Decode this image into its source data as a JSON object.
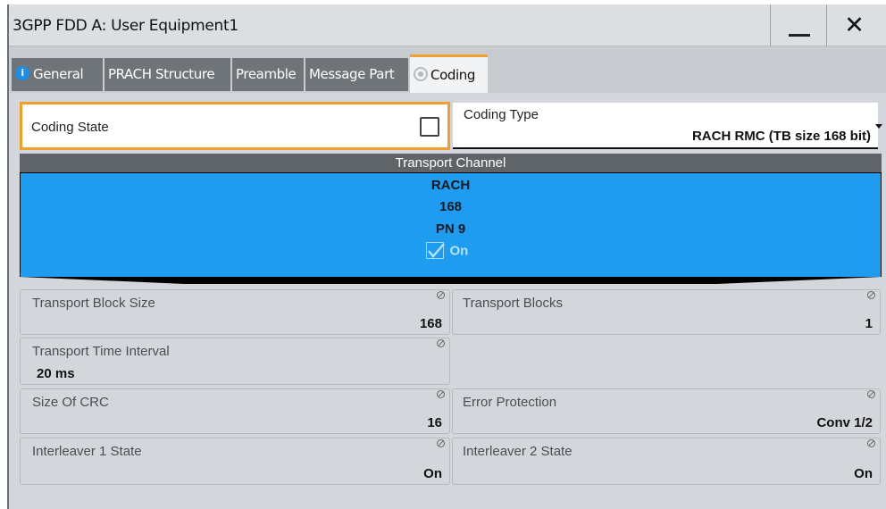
{
  "window": {
    "title": "3GPP FDD A: User Equipment1",
    "minimize_icon": "minimize-icon",
    "close_label": "✕"
  },
  "tabs": [
    {
      "label": "General",
      "icon": "info-icon"
    },
    {
      "label": "PRACH Structure"
    },
    {
      "label": "Preamble"
    },
    {
      "label": "Message Part"
    },
    {
      "label": "Coding",
      "icon": "state-ring-icon",
      "active": true
    }
  ],
  "coding_state": {
    "label": "Coding State",
    "checked": false
  },
  "coding_type": {
    "label": "Coding Type",
    "value": "RACH RMC (TB size 168 bit)"
  },
  "transport_channel": {
    "header": "Transport Channel",
    "lines": [
      "RACH",
      "168",
      "PN 9"
    ],
    "on_label": "On",
    "on_checked": true
  },
  "fields": {
    "transport_block_size": {
      "label": "Transport Block Size",
      "value": "168"
    },
    "transport_blocks": {
      "label": "Transport Blocks",
      "value": "1"
    },
    "transport_time_interval": {
      "label": "Transport Time Interval",
      "value": "20 ms"
    },
    "size_of_crc": {
      "label": "Size Of CRC",
      "value": "16"
    },
    "error_protection": {
      "label": "Error Protection",
      "value": "Conv 1/2"
    },
    "interleaver1_state": {
      "label": "Interleaver 1 State",
      "value": "On"
    },
    "interleaver2_state": {
      "label": "Interleaver 2 State",
      "value": "On"
    }
  },
  "colors": {
    "accent": "#f1a02a",
    "channel_blue": "#1e9cf0",
    "tab_inactive": "#6f7478",
    "info_blue": "#1a8ee8"
  }
}
